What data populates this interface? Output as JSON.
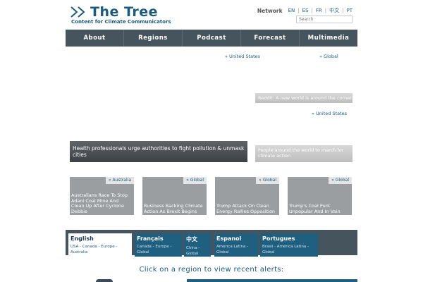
{
  "brand": {
    "title": "The Tree",
    "tagline": "Content for Climate Communicators",
    "accent": "#1a5a7e"
  },
  "network": {
    "label": "Network",
    "languages": [
      "EN",
      "ES",
      "FR",
      "中文",
      "PT"
    ]
  },
  "search": {
    "placeholder": "Search"
  },
  "nav": [
    "About",
    "Regions",
    "Podcast",
    "Forecast",
    "Multimedia"
  ],
  "hero": {
    "main_tag": "» United States",
    "main_title": "Health professionals urge authorities to fight pollution & unmask cities",
    "side1_tag": "» Global",
    "side1_title": "Reddit: A new world is around the corner",
    "side2_tag": "» United States",
    "side2_title": "People around the world to march for climate action"
  },
  "cards": [
    {
      "tag": "» Australia",
      "title": "Australians Race To Stop Adani Coal Mine And Clean Up After Cyclone Debbie"
    },
    {
      "tag": "» Global",
      "title": "Business Backing Climate Action As Brexit Begins"
    },
    {
      "tag": "» Global",
      "title": "Trump Attack On Clean Energy Rallies Opposition"
    },
    {
      "tag": "» Global",
      "title": "Trump's Coal Punt Unpopular And In Vain"
    }
  ],
  "language_tabs": [
    {
      "name": "English",
      "regions": "USA - Canada - Europe - Australia"
    },
    {
      "name": "Français",
      "regions": "Canada - Europe - Global"
    },
    {
      "name": "中文",
      "regions": "China - Global"
    },
    {
      "name": "Espanol",
      "regions": "America Latina - Global"
    },
    {
      "name": "Portugues",
      "regions": "Brasil - América Latina - Global"
    }
  ],
  "prompt": "Click on a region to view recent alerts:"
}
